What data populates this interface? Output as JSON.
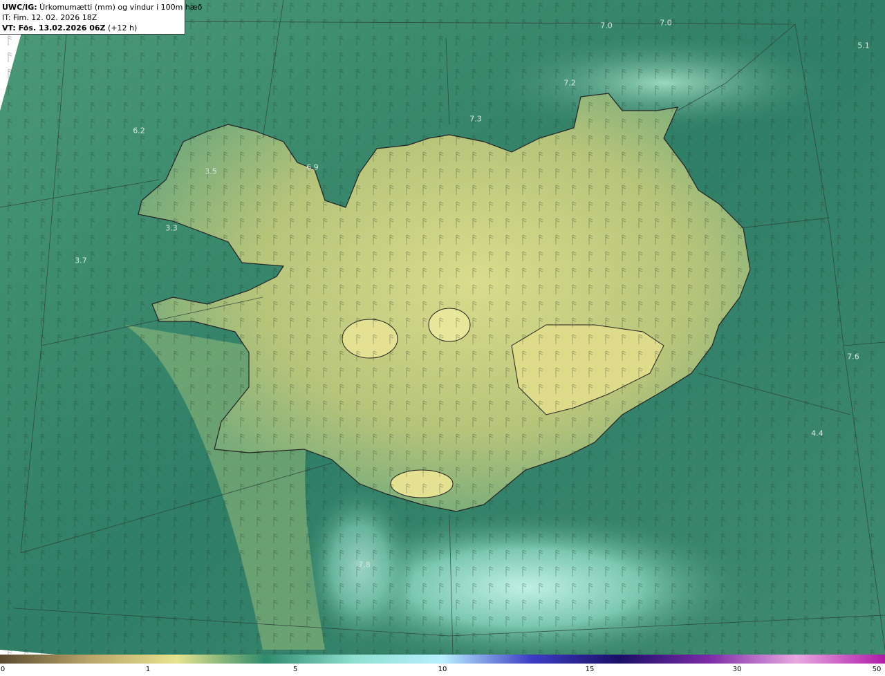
{
  "header": {
    "product": "UWC/IG:",
    "product_desc": " Úrkomumætti (mm) og vindur i 100m hæð",
    "init_time": "IT: Fim. 12. 02. 2026 18Z",
    "valid_prefix": "VT: Fös. 13.02.2026 06Z",
    "valid_suffix": " (+12 h)"
  },
  "map": {
    "labels": [
      "7.0",
      "7.0",
      "5.1",
      "7.2",
      "7.3",
      "6.2",
      "3.5",
      "6.9",
      "3.3",
      "3.7",
      "4.4",
      "7.6",
      "7.8"
    ]
  },
  "colorbar": {
    "ticks": [
      "0",
      "1",
      "5",
      "10",
      "15",
      "30",
      "50"
    ],
    "colors": [
      "#5a4a2e",
      "#b9a46a",
      "#e6e48e",
      "#2f8a6c",
      "#8fe0d0",
      "#b8f0ff",
      "#3d3dc4",
      "#1a1066",
      "#7a2aa6",
      "#e8a8e0",
      "#b01aa6"
    ]
  },
  "theme": {
    "land_base": "#b8c878",
    "sea_base": "#3f8a70",
    "coast": "#222222"
  }
}
